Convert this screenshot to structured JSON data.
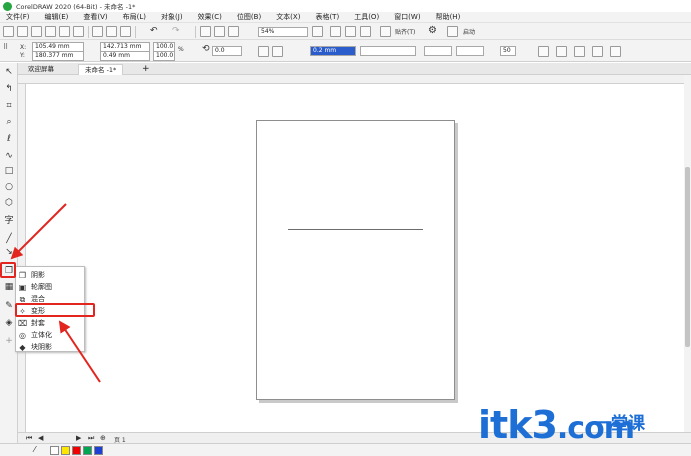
{
  "window": {
    "title": "CorelDRAW 2020 (64-Bit) - 未命名 -1*"
  },
  "menu": [
    "文件(F)",
    "编辑(E)",
    "查看(V)",
    "布局(L)",
    "对象(J)",
    "效果(C)",
    "位图(B)",
    "文本(X)",
    "表格(T)",
    "工具(O)",
    "窗口(W)",
    "帮助(H)"
  ],
  "toolbar": {
    "zoom": "54%",
    "snap_label": "贴齐(T)",
    "auto_label": "启动"
  },
  "property_bar": {
    "x": "105.49 mm",
    "y": "180.377 mm",
    "width": "142.713 mm",
    "height": "0.49 mm",
    "scale_w": "100.0",
    "scale_h": "100.0",
    "percent": "%",
    "rotation": "0.0",
    "outline_width": "0.2 mm",
    "node_size": "50"
  },
  "tabs": [
    "欢迎屏幕",
    "未命名 -1*"
  ],
  "flyout": {
    "items": [
      {
        "label": "阴影",
        "icon": "shadow-icon"
      },
      {
        "label": "轮廓图",
        "icon": "contour-icon"
      },
      {
        "label": "混合",
        "icon": "blend-icon"
      },
      {
        "label": "变形",
        "icon": "distort-icon"
      },
      {
        "label": "封套",
        "icon": "envelope-icon"
      },
      {
        "label": "立体化",
        "icon": "extrude-icon"
      },
      {
        "label": "块阴影",
        "icon": "block-shadow-icon"
      }
    ]
  },
  "statusbar": {
    "page_label": "页 1"
  },
  "palette": {
    "colors": [
      "#ffffff",
      "#ffe600",
      "#f00000",
      "#00a651",
      "#1c3fd6"
    ]
  },
  "watermark": {
    "text": "itk3",
    "suffix": "一堂课",
    "domain": ".com"
  }
}
